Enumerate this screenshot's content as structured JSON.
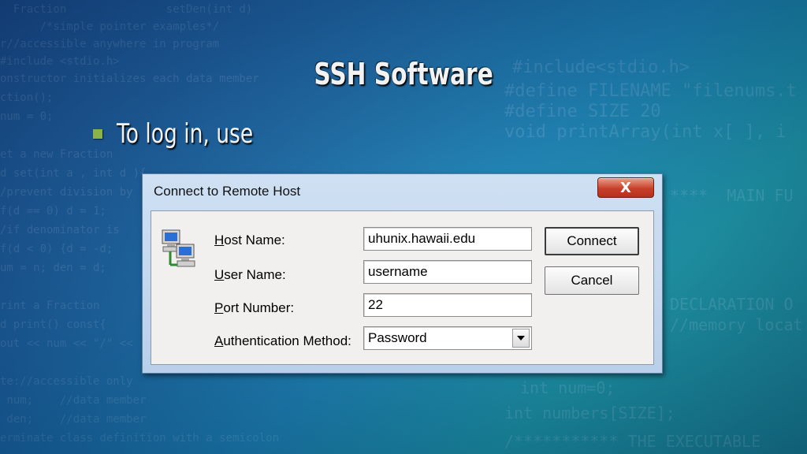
{
  "slide": {
    "title": "SSH Software",
    "bullet": "To log in, use"
  },
  "dialog": {
    "title": "Connect to Remote Host",
    "close_label": "X",
    "icon": "network-computers-icon",
    "fields": {
      "host": {
        "label_accel": "H",
        "label_rest": "ost Name:",
        "value": "uhunix.hawaii.edu"
      },
      "user": {
        "label_accel": "U",
        "label_rest": "ser Name:",
        "value": "username"
      },
      "port": {
        "label_accel": "P",
        "label_rest": "ort Number:",
        "value": "22"
      },
      "auth": {
        "label_accel": "A",
        "label_rest": "uthentication Method:",
        "value": "Password"
      }
    },
    "buttons": {
      "connect": "Connect",
      "cancel": "Cancel"
    }
  },
  "colors": {
    "bullet": "#8cb24a",
    "close_button": "#c8402a",
    "dialog_frame": "#cfe0f3"
  }
}
